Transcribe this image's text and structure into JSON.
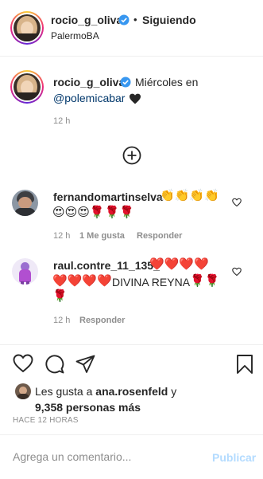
{
  "header": {
    "username": "rocio_g_oliva",
    "separator": "•",
    "follow_status": "Siguiendo",
    "location": "PalermoBA"
  },
  "caption": {
    "username": "rocio_g_oliva",
    "text_pre": "Miércoles en",
    "mention": "@polemicabar",
    "emoji": "🖤",
    "time": "12 h"
  },
  "load_more_icon": "plus-circle-icon",
  "comments": [
    {
      "username": "fernandomartinselva",
      "line1_emoji": "👏👏👏👏",
      "line2_emoji": "😍😍😍🌹🌹🌹",
      "time": "12 h",
      "likes": "1 Me gusta",
      "reply": "Responder"
    },
    {
      "username": "raul.contre_11_135_",
      "line1_emoji": "❤️❤️❤️❤️",
      "line2_emoji": "❤️❤️❤️❤️",
      "line2_text": "DIVINA REYNA",
      "line2_emoji_after": "🌹🌹",
      "line3_emoji": "🌹",
      "time": "12 h",
      "reply": "Responder"
    }
  ],
  "actions": {
    "like_icon": "heart-icon",
    "comment_icon": "comment-icon",
    "share_icon": "paper-plane-icon",
    "save_icon": "bookmark-icon"
  },
  "likes": {
    "prefix": "Les gusta a",
    "user": "ana.rosenfeld",
    "conj": "y",
    "count": "9,358 personas más"
  },
  "timestamp": "HACE 12 HORAS",
  "comment_box": {
    "placeholder": "Agrega un comentario...",
    "submit": "Publicar"
  },
  "colors": {
    "verified": "#3897f0",
    "link": "#00376b",
    "muted": "#8e8e8e",
    "publish_disabled": "#b3dbff"
  }
}
